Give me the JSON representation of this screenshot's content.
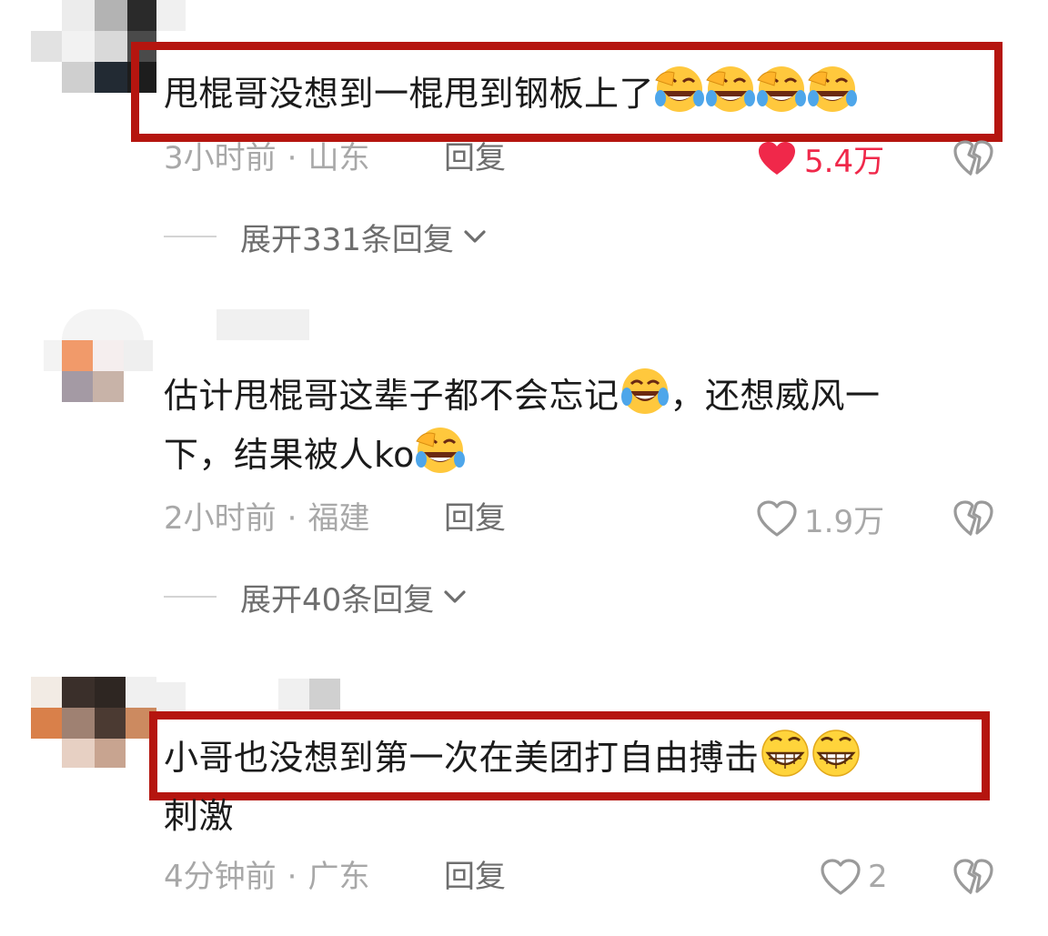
{
  "comments": [
    {
      "text": "甩棍哥没想到一棍甩到钢板上了",
      "emojis": [
        "laughing-crying-emoji",
        "laughing-crying-emoji",
        "laughing-crying-emoji",
        "laughing-crying-emoji"
      ],
      "time": "3小时前",
      "location": "山东",
      "reply_label": "回复",
      "likes": "5.4万",
      "liked": true,
      "expand_label": "展开331条回复",
      "highlighted": true
    },
    {
      "text_line1": "估计甩棍哥这辈子都不会忘记",
      "text_line1b": "，还想威风一",
      "text_line2": "下，结果被人ko",
      "emojis": [
        "tears-of-joy-emoji",
        "laughing-crying-emoji"
      ],
      "time": "2小时前",
      "location": "福建",
      "reply_label": "回复",
      "likes": "1.9万",
      "liked": false,
      "expand_label": "展开40条回复",
      "highlighted": false
    },
    {
      "text": "小哥也没想到第一次在美团打自由搏击",
      "text_line2": "刺激",
      "emojis": [
        "grinning-emoji",
        "grinning-emoji"
      ],
      "time": "4分钟前",
      "location": "广东",
      "reply_label": "回复",
      "likes": "2",
      "liked": false,
      "highlighted": true
    }
  ],
  "meta_separator": "·",
  "colors": {
    "highlight_border": "#b5150f",
    "liked_red": "#f0284a",
    "meta_gray": "#a8a8a8",
    "text": "#1b1b1b"
  }
}
